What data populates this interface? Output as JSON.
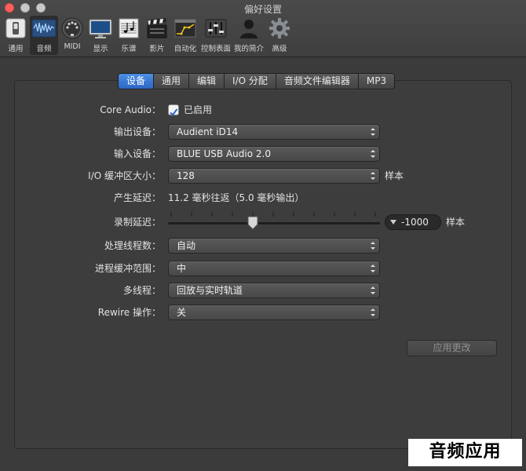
{
  "window": {
    "title": "偏好设置"
  },
  "toolbar": {
    "items": [
      {
        "label": "通用",
        "icon": "switch-icon"
      },
      {
        "label": "音频",
        "icon": "waveform-icon",
        "active": true
      },
      {
        "label": "MIDI",
        "icon": "midi-connector-icon"
      },
      {
        "label": "显示",
        "icon": "monitor-icon"
      },
      {
        "label": "乐谱",
        "icon": "score-notes-icon"
      },
      {
        "label": "影片",
        "icon": "clapper-icon"
      },
      {
        "label": "自动化",
        "icon": "automation-curve-icon"
      },
      {
        "label": "控制表面",
        "icon": "faders-icon"
      },
      {
        "label": "我的简介",
        "icon": "person-icon"
      },
      {
        "label": "高级",
        "icon": "gear-icon"
      }
    ]
  },
  "tabs": [
    {
      "label": "设备",
      "selected": true
    },
    {
      "label": "通用"
    },
    {
      "label": "编辑"
    },
    {
      "label": "I/O 分配"
    },
    {
      "label": "音频文件编辑器"
    },
    {
      "label": "MP3"
    }
  ],
  "settings": {
    "core_audio": {
      "label": "Core Audio：",
      "checkbox_label": "已启用",
      "checked": true
    },
    "output_device": {
      "label": "输出设备：",
      "value": "Audient iD14"
    },
    "input_device": {
      "label": "输入设备：",
      "value": "BLUE USB Audio 2.0"
    },
    "buffer_size": {
      "label": "I/O 缓冲区大小：",
      "value": "128",
      "unit": "样本"
    },
    "latency": {
      "label": "产生延迟：",
      "value": "11.2 毫秒往返（5.0 毫秒输出）"
    },
    "record_delay": {
      "label": "录制延迟：",
      "value": "-1000",
      "unit": "样本",
      "slider_fraction": 0.4
    },
    "processing_threads": {
      "label": "处理线程数：",
      "value": "自动"
    },
    "process_buffer_range": {
      "label": "进程缓冲范围：",
      "value": "中"
    },
    "multithreading": {
      "label": "多线程：",
      "value": "回放与实时轨道"
    },
    "rewire": {
      "label": "Rewire 操作：",
      "value": "关"
    }
  },
  "apply_button": {
    "label": "应用更改",
    "enabled": false
  },
  "watermark": {
    "text": "音频应用"
  },
  "colors": {
    "accent": "#3a7bd5",
    "background": "#3b3b3b",
    "close": "#fc605c"
  }
}
